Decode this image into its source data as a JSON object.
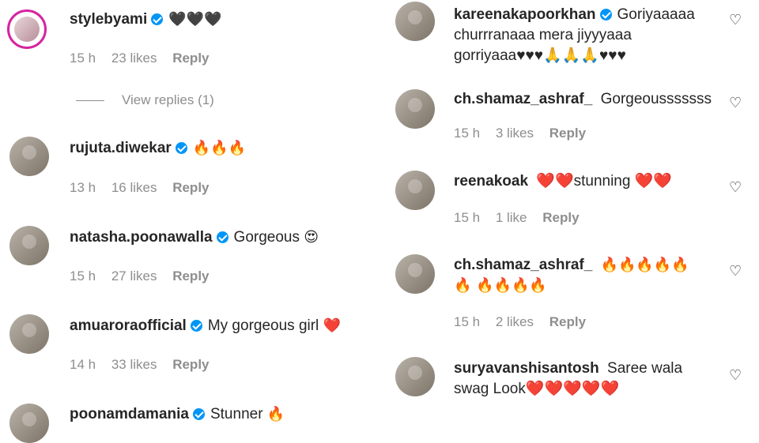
{
  "left": {
    "comments": [
      {
        "user": "stylebyami",
        "verified": true,
        "text": "",
        "emoji": "🖤🖤🖤",
        "time": "15 h",
        "likes": "23 likes",
        "reply": "Reply"
      },
      {
        "user": "rujuta.diwekar",
        "verified": true,
        "text": "",
        "emoji": "🔥🔥🔥",
        "time": "13 h",
        "likes": "16 likes",
        "reply": "Reply"
      },
      {
        "user": "natasha.poonawalla",
        "verified": true,
        "text": "Gorgeous",
        "emoji": "😍",
        "time": "15 h",
        "likes": "27 likes",
        "reply": "Reply"
      },
      {
        "user": "amuaroraofficial",
        "verified": true,
        "text": "My gorgeous girl",
        "emoji": "❤️",
        "time": "14 h",
        "likes": "33 likes",
        "reply": "Reply"
      },
      {
        "user": "poonamdamania",
        "verified": true,
        "text": "Stunner",
        "emoji": "🔥",
        "time": "",
        "likes": "",
        "reply": ""
      }
    ],
    "view_replies": "View replies (1)"
  },
  "right": {
    "comments": [
      {
        "user": "kareenakapoorkhan",
        "verified": true,
        "text": "Goriyaaaaa churrranaaa mera jiyyyaaa gorriyaaa♥♥♥🙏🙏🙏♥♥♥",
        "emoji": "",
        "time": "",
        "likes": "",
        "reply": ""
      },
      {
        "user": "ch.shamaz_ashraf_",
        "verified": false,
        "text": "Gorgeousssssss",
        "emoji": "",
        "time": "15 h",
        "likes": "3 likes",
        "reply": "Reply"
      },
      {
        "user": "reenakoak",
        "verified": false,
        "text": "❤️❤️stunning ❤️❤️",
        "emoji": "",
        "time": "15 h",
        "likes": "1 like",
        "reply": "Reply"
      },
      {
        "user": "ch.shamaz_ashraf_",
        "verified": false,
        "text": "🔥🔥🔥🔥🔥🔥 🔥🔥🔥🔥",
        "emoji": "",
        "time": "15 h",
        "likes": "2 likes",
        "reply": "Reply"
      },
      {
        "user": "suryavanshisantosh",
        "verified": false,
        "text": "Saree wala swag Look❤️❤️❤️❤️❤️",
        "emoji": "",
        "time": "",
        "likes": "",
        "reply": ""
      }
    ]
  },
  "icons": {
    "heart": "heart-outline-icon",
    "verified": "verified-badge-icon"
  },
  "colors": {
    "verified": "#0095f6",
    "meta_text": "#8e8e8e",
    "story_ring": "#d6249f"
  }
}
